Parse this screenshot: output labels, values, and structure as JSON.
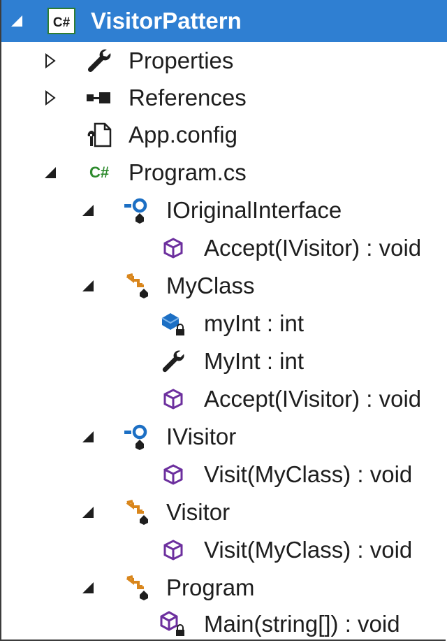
{
  "tree": {
    "root": {
      "label": "VisitorPattern",
      "icon": "csharp-project-icon",
      "expanded": true
    },
    "items": [
      {
        "label": "Properties",
        "icon": "wrench-icon",
        "expander": "collapsed"
      },
      {
        "label": "References",
        "icon": "references-icon",
        "expander": "collapsed"
      },
      {
        "label": "App.config",
        "icon": "config-file-icon",
        "expander": "none"
      },
      {
        "label": "Program.cs",
        "icon": "csharp-file-icon",
        "expander": "expanded"
      },
      {
        "label": "IOriginalInterface",
        "icon": "interface-icon",
        "expander": "expanded"
      },
      {
        "label": "Accept(IVisitor) : void",
        "icon": "method-icon",
        "expander": "none"
      },
      {
        "label": "MyClass",
        "icon": "class-icon",
        "expander": "expanded"
      },
      {
        "label": "myInt : int",
        "icon": "private-field-icon",
        "expander": "none"
      },
      {
        "label": "MyInt : int",
        "icon": "property-icon",
        "expander": "none"
      },
      {
        "label": "Accept(IVisitor) : void",
        "icon": "method-icon",
        "expander": "none"
      },
      {
        "label": "IVisitor",
        "icon": "interface-icon",
        "expander": "expanded"
      },
      {
        "label": "Visit(MyClass) : void",
        "icon": "method-icon",
        "expander": "none"
      },
      {
        "label": "Visitor",
        "icon": "class-icon",
        "expander": "expanded"
      },
      {
        "label": "Visit(MyClass) : void",
        "icon": "method-icon",
        "expander": "none"
      },
      {
        "label": "Program",
        "icon": "class-icon",
        "expander": "expanded"
      },
      {
        "label": "Main(string[]) : void",
        "icon": "private-method-icon",
        "expander": "none"
      }
    ]
  },
  "colors": {
    "selection": "#2f7fd2",
    "csharp_green": "#2e8b2e",
    "method_purple": "#6c2f9e",
    "interface_blue": "#1c6fc4",
    "class_orange": "#d9861c"
  }
}
